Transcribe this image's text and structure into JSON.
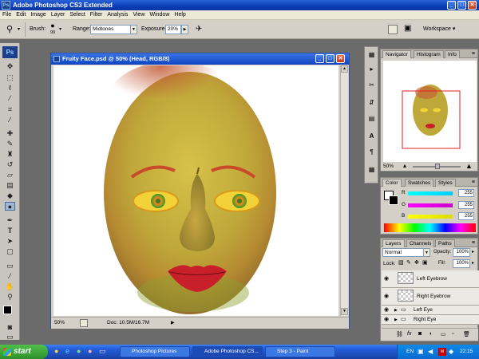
{
  "window": {
    "title": "Adobe Photoshop CS3 Extended",
    "app_badge": "Ps",
    "min": "_",
    "max": "□",
    "close": "✕"
  },
  "menu": [
    "File",
    "Edit",
    "Image",
    "Layer",
    "Select",
    "Filter",
    "Analysis",
    "View",
    "Window",
    "Help"
  ],
  "options": {
    "brush_label": "Brush:",
    "brush_size": "99",
    "range_label": "Range:",
    "range_value": "Midtones",
    "exposure_label": "Exposure:",
    "exposure_value": "20%",
    "workspace_label": "Workspace ▾"
  },
  "document": {
    "title": "Fruity Face.psd @ 50% (Head, RGB/8)",
    "zoom": "50%",
    "doc_info": "Doc: 10.5M/16.7M"
  },
  "navigator": {
    "tabs": [
      "Navigator",
      "Histogram",
      "Info"
    ],
    "zoom": "50%"
  },
  "color_panel": {
    "tabs": [
      "Color",
      "Swatches",
      "Styles"
    ],
    "channels": [
      {
        "label": "R",
        "value": "255",
        "color": "#00c0d0"
      },
      {
        "label": "G",
        "value": "255",
        "color": "#d000c0"
      },
      {
        "label": "B",
        "value": "255",
        "color": "#e0d000"
      }
    ]
  },
  "layers_panel": {
    "tabs": [
      "Layers",
      "Channels",
      "Paths"
    ],
    "blend_mode": "Normal",
    "opacity_label": "Opacity:",
    "opacity": "100%",
    "lock_label": "Lock:",
    "fill_label": "Fill:",
    "fill": "100%",
    "layers": [
      {
        "name": "Left Eyebrow",
        "kind": "pixel"
      },
      {
        "name": "Right Eyebrow",
        "kind": "pixel"
      },
      {
        "name": "Left Eye",
        "kind": "group"
      },
      {
        "name": "Right Eye",
        "kind": "group"
      }
    ]
  },
  "taskbar": {
    "start": "start",
    "items": [
      {
        "label": "Photoshop Pictures",
        "active": false
      },
      {
        "label": "Adobe Photoshop CS...",
        "active": true
      },
      {
        "label": "Step 3 - Paint",
        "active": false
      }
    ],
    "lang": "EN",
    "clock": "22:15"
  },
  "colors": {
    "xp_blue": "#0a3fb8",
    "panel_gray": "#d4d0c8",
    "workspace_gray": "#6b6b6b",
    "start_green": "#2f8f2c"
  }
}
